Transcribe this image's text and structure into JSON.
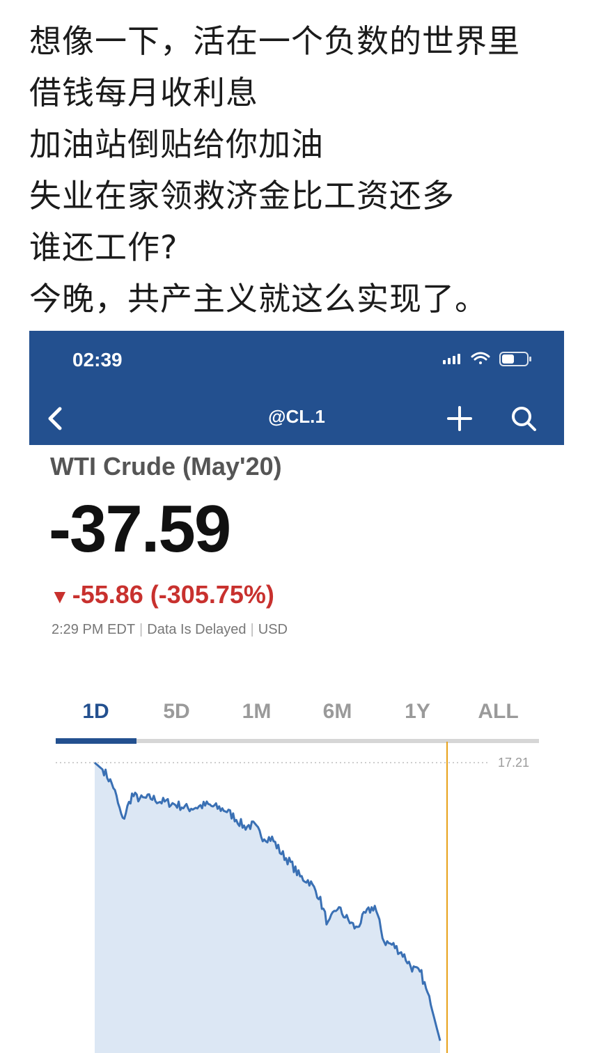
{
  "post": {
    "lines": [
      "想像一下，活在一个负数的世界里",
      "借钱每月收利息",
      "加油站倒贴给你加油",
      "失业在家领救济金比工资还多",
      "谁还工作?",
      "今晚，共产主义就这么实现了。"
    ]
  },
  "screenshot": {
    "status_bar": {
      "time": "02:39",
      "icons": [
        "signal-icon",
        "wifi-icon",
        "battery-icon"
      ],
      "battery_level": 0.5
    },
    "nav": {
      "title": "@CL.1",
      "back_icon": "chevron-left-icon",
      "add_icon": "plus-icon",
      "search_icon": "search-icon"
    },
    "quote": {
      "name": "WTI Crude (May'20)",
      "price": "-37.59",
      "change_arrow": "▼",
      "change": "-55.86 (-305.75%)",
      "time": "2:29 PM EDT",
      "delay": "Data Is Delayed",
      "currency": "USD"
    },
    "tabs": [
      {
        "label": "1D",
        "active": true
      },
      {
        "label": "5D",
        "active": false
      },
      {
        "label": "1M",
        "active": false
      },
      {
        "label": "6M",
        "active": false
      },
      {
        "label": "1Y",
        "active": false
      },
      {
        "label": "ALL",
        "active": false
      }
    ],
    "colors": {
      "brand": "#23508f",
      "negative": "#c8312e",
      "line": "#3a70b4",
      "fill": "#dce7f4",
      "cursor": "#e8a21a"
    }
  },
  "chart_data": {
    "type": "area",
    "title": "",
    "xlabel": "",
    "ylabel": "",
    "y_tick_labels": [
      "17.21"
    ],
    "reference_level": 17.21,
    "ylim": [
      -40,
      17.5
    ],
    "grid": false,
    "legend": "none",
    "series": [
      {
        "values": [
          17.21,
          15.6,
          12.5,
          5.8,
          10.8,
          10.0,
          10.3,
          9.6,
          9.3,
          8.8,
          8.2,
          8.5,
          8.9,
          8.4,
          7.9,
          6.4,
          4.6,
          4.9,
          2.6,
          2.2,
          -0.6,
          -2.6,
          -5.3,
          -6.2,
          -9.0,
          -14.8,
          -11.3,
          -13.5,
          -15.5,
          -12.6,
          -11.0,
          -18.0,
          -18.8,
          -20.5,
          -23.2,
          -24.5,
          -30.5,
          -37.59
        ],
        "cursor_index": 37
      }
    ]
  }
}
